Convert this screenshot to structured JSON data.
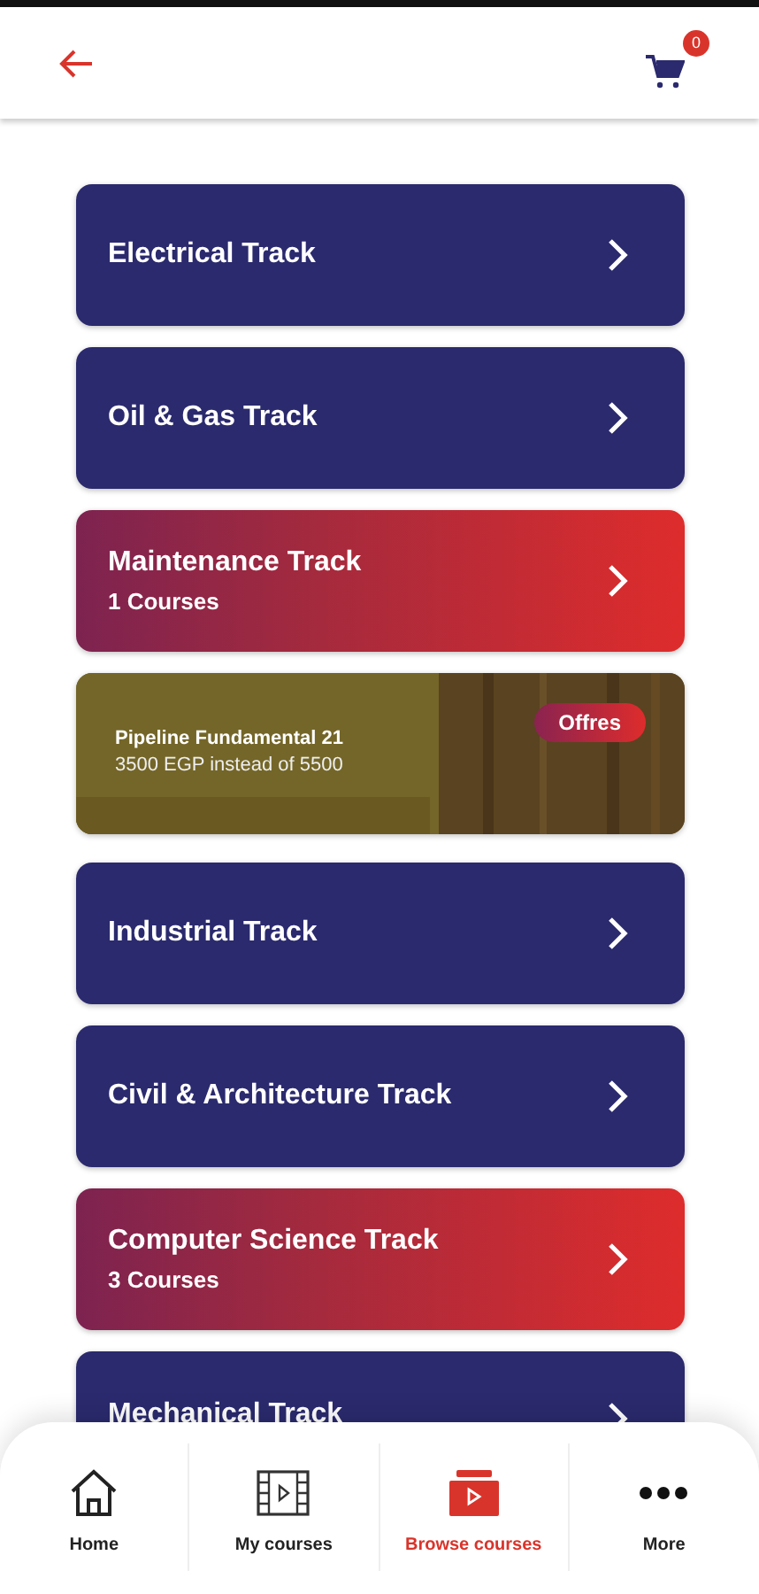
{
  "header": {
    "cart_count": "0"
  },
  "tracks": [
    {
      "kind": "plain",
      "title": "Electrical Track"
    },
    {
      "kind": "plain",
      "title": "Oil & Gas Track"
    },
    {
      "kind": "highlight",
      "title": "Maintenance Track",
      "subtitle": "1 Courses"
    },
    {
      "kind": "offer",
      "title": "Pipeline Fundamental 21",
      "subtitle": "3500 EGP instead of 5500",
      "badge": "Offres"
    },
    {
      "kind": "plain",
      "title": "Industrial Track"
    },
    {
      "kind": "plain",
      "title": "Civil & Architecture Track"
    },
    {
      "kind": "highlight",
      "title": "Computer Science Track",
      "subtitle": "3 Courses"
    },
    {
      "kind": "plain",
      "title": "Mechanical Track"
    }
  ],
  "nav": [
    {
      "kind": "home",
      "label": "Home",
      "selected": false
    },
    {
      "kind": "courses",
      "label": "My courses",
      "selected": false
    },
    {
      "kind": "browse",
      "label": "Browse courses",
      "selected": true
    },
    {
      "kind": "more",
      "label": "More",
      "selected": false
    }
  ]
}
